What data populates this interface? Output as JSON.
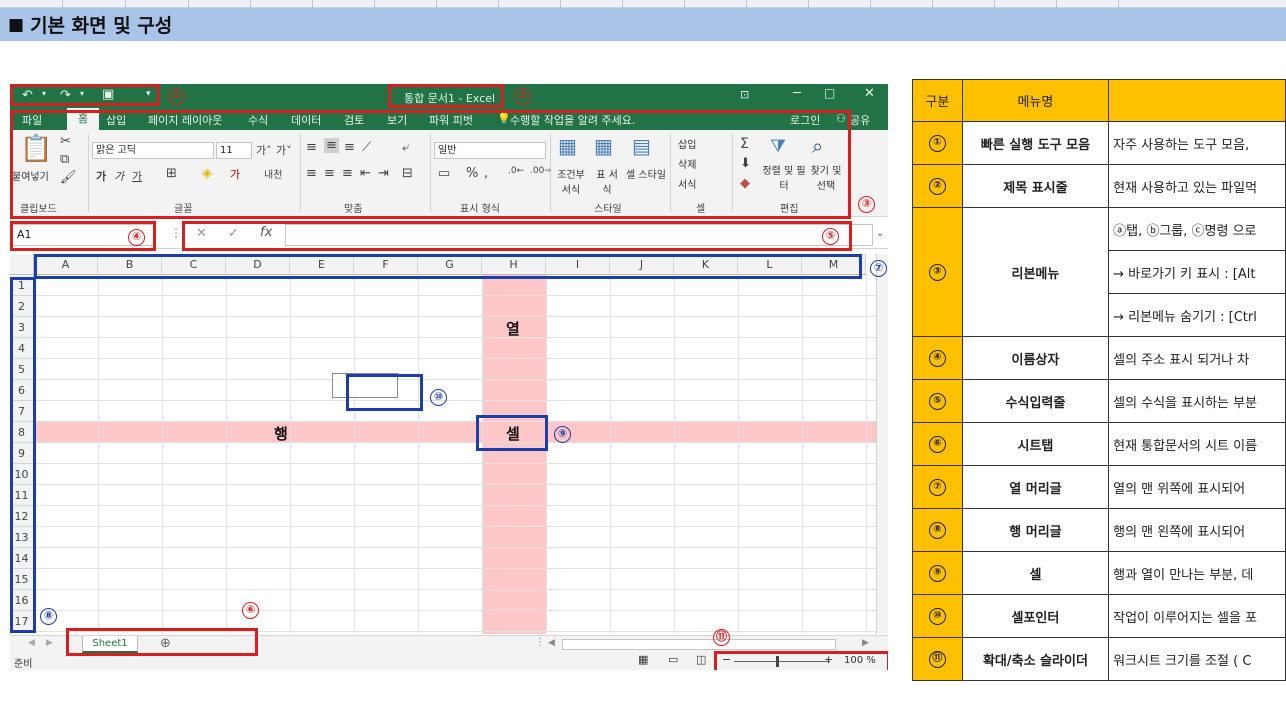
{
  "header": {
    "title": "기본 화면 및 구성",
    "bullet": "■"
  },
  "excel": {
    "window_title": "통합 문서1 - Excel",
    "tabs": [
      "파일",
      "홈",
      "삽입",
      "페이지 레이아웃",
      "수식",
      "데이터",
      "검토",
      "보기",
      "파워 피벗"
    ],
    "tell_me": "수행할 작업을 알려 주세요.",
    "login": "로그인",
    "share": "공유",
    "font_name": "맑은 고딕",
    "font_size": "11",
    "number_format": "일반",
    "paste_label": "붙여넣기",
    "groups": [
      "클립보드",
      "글꼴",
      "맞춤",
      "표시 형식",
      "스타일",
      "셀",
      "편집"
    ],
    "style_buttons": [
      "조건부 서식",
      "표 서식",
      "셀 스타일"
    ],
    "cell_buttons": [
      "삽입",
      "삭제",
      "서식"
    ],
    "edit_buttons": [
      "정렬 및 필터",
      "찾기 및 선택"
    ],
    "name_box": "A1",
    "columns": [
      "A",
      "B",
      "C",
      "D",
      "E",
      "F",
      "G",
      "H",
      "I",
      "J",
      "K",
      "L",
      "M"
    ],
    "rows": [
      "1",
      "2",
      "3",
      "4",
      "5",
      "6",
      "7",
      "8",
      "9",
      "10",
      "11",
      "12",
      "13",
      "14",
      "15",
      "16",
      "17"
    ],
    "label_col": "열",
    "label_row": "행",
    "label_cell": "셀",
    "sheet_tab": "Sheet1",
    "status": "준비",
    "zoom": "100 %"
  },
  "markers": [
    "①",
    "②",
    "③",
    "④",
    "⑤",
    "⑥",
    "⑦",
    "⑧",
    "⑨",
    "⑩",
    "⑪"
  ],
  "table": {
    "headers": [
      "구분",
      "메뉴명",
      ""
    ],
    "rows": [
      {
        "no": "①",
        "name": "빠른 실행 도구 모음",
        "desc": "자주 사용하는 도구 모음,"
      },
      {
        "no": "②",
        "name": "제목 표시줄",
        "desc": "현재 사용하고 있는 파일먹"
      },
      {
        "no": "③",
        "name": "리본메뉴",
        "desc": "ⓐ탭, ⓑ그룹, ⓒ명령 으로"
      },
      {
        "no": "",
        "name": "",
        "desc": "→ 바로가기 키 표시 : [Alt"
      },
      {
        "no": "",
        "name": "",
        "desc": "→ 리본메뉴 숨기기 : [Ctrl"
      },
      {
        "no": "④",
        "name": "이름상자",
        "desc": "셀의 주소 표시 되거나 차"
      },
      {
        "no": "⑤",
        "name": "수식입력줄",
        "desc": "셀의 수식을 표시하는 부분"
      },
      {
        "no": "⑥",
        "name": "시트탭",
        "desc": "현재 통합문서의 시트 이름"
      },
      {
        "no": "⑦",
        "name": "열 머리글",
        "desc": "열의 맨 위쪽에 표시되어"
      },
      {
        "no": "⑧",
        "name": "행 머리글",
        "desc": "행의 맨 왼쪽에 표시되어"
      },
      {
        "no": "⑨",
        "name": "셀",
        "desc": "행과 열이 만나는 부분, 데"
      },
      {
        "no": "⑩",
        "name": "셀포인터",
        "desc": "작업이 이루어지는 셀을 포"
      },
      {
        "no": "⑪",
        "name": "확대/축소 슬라이더",
        "desc": "워크시트 크기를 조절 ( C"
      }
    ]
  }
}
